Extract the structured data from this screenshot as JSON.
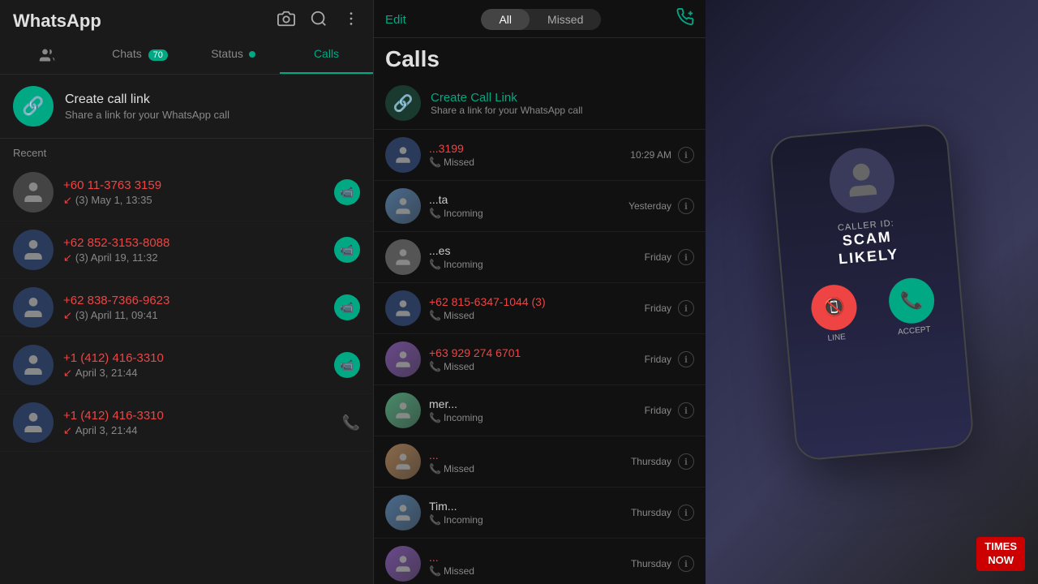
{
  "app": {
    "title": "WhatsApp"
  },
  "header_icons": [
    "camera",
    "search",
    "more"
  ],
  "nav": {
    "people_tab": "",
    "chats_tab": "Chats",
    "chats_badge": "70",
    "status_tab": "Status",
    "calls_tab": "Calls"
  },
  "create_link": {
    "title": "Create call link",
    "subtitle": "Share a link for your WhatsApp call"
  },
  "recent_label": "Recent",
  "left_calls": [
    {
      "name": "+60 11-3763 3159",
      "meta": "(3) May 1, 13:35",
      "type": "missed",
      "action": "video"
    },
    {
      "name": "+62 852-3153-8088",
      "meta": "(3) April 19, 11:32",
      "type": "missed",
      "action": "video"
    },
    {
      "name": "+62 838-7366-9623",
      "meta": "(3) April 11, 09:41",
      "type": "missed",
      "action": "video"
    },
    {
      "name": "+1 (412) 416-3310",
      "meta": "April 3, 21:44",
      "type": "missed",
      "action": "video"
    },
    {
      "name": "+1 (412) 416-3310",
      "meta": "April 3, 21:44",
      "type": "missed",
      "action": "phone"
    }
  ],
  "middle": {
    "edit_label": "Edit",
    "filter_all": "All",
    "filter_missed": "Missed",
    "title": "Calls",
    "create_link_title": "Create Call Link",
    "create_link_subtitle": "Share a link for your WhatsApp call",
    "calls": [
      {
        "name": "...3199",
        "sub_type": "Missed",
        "sub_icon": "phone",
        "time": "10:29 AM",
        "color": "red"
      },
      {
        "name": "...ta",
        "sub_type": "Incoming",
        "sub_icon": "phone",
        "time": "Yesterday",
        "color": "gray"
      },
      {
        "name": "...es",
        "sub_type": "Incoming",
        "sub_icon": "phone",
        "time": "Friday",
        "color": "gray"
      },
      {
        "name": "+62 815-6347-1044 (3)",
        "sub_type": "Missed",
        "sub_icon": "phone",
        "time": "Friday",
        "color": "red"
      },
      {
        "name": "+63 929 274 6701",
        "sub_type": "Missed",
        "sub_icon": "phone",
        "time": "Friday",
        "color": "red"
      },
      {
        "name": "mer...",
        "sub_type": "Incoming",
        "sub_icon": "phone",
        "time": "Friday",
        "color": "gray"
      },
      {
        "name": "...",
        "sub_type": "Missed",
        "sub_icon": "phone",
        "time": "Thursday",
        "color": "red"
      },
      {
        "name": "Tim...",
        "sub_type": "Incoming",
        "sub_icon": "phone",
        "time": "Thursday",
        "color": "gray"
      },
      {
        "name": "...",
        "sub_type": "Missed",
        "sub_icon": "phone",
        "time": "Thursday",
        "color": "red"
      }
    ]
  },
  "phone_screen": {
    "caller_label": "CALLER ID:",
    "scam_label": "SCAM LIKELY",
    "decline_label": "LINE",
    "accept_label": "ACCEPT"
  },
  "times_now": "TIMES\nNOW"
}
